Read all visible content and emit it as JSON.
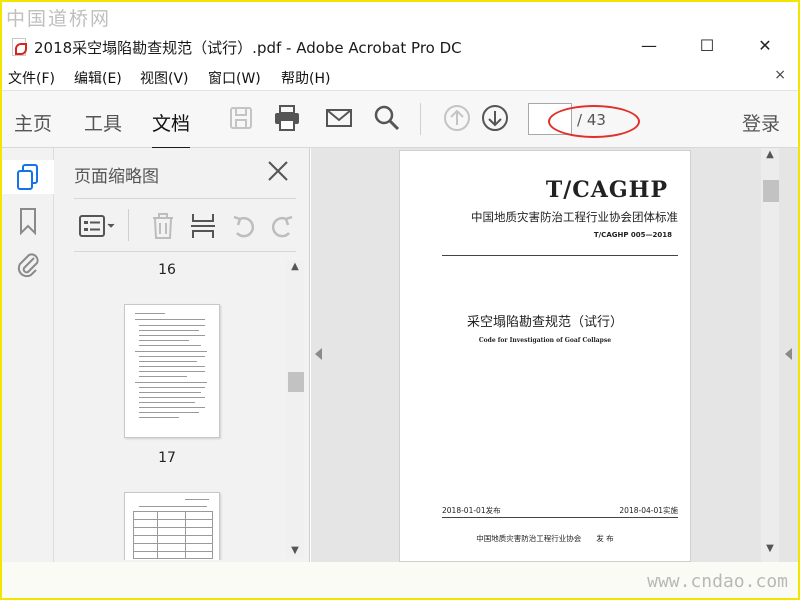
{
  "watermark_top": "中国道桥网",
  "watermark_bottom": "www.cndao.com",
  "window": {
    "title": "2018采空塌陷勘查规范（试行）.pdf - Adobe Acrobat Pro DC",
    "minimize": "—",
    "maximize": "☐",
    "close": "✕"
  },
  "menu": {
    "items": [
      "文件(F)",
      "编辑(E)",
      "视图(V)",
      "窗口(W)",
      "帮助(H)"
    ],
    "close": "×"
  },
  "toolbar": {
    "tabs": [
      "主页",
      "工具",
      "文档"
    ],
    "active_tab": "文档",
    "page_current": "",
    "page_total": "/ 43",
    "login": "登录"
  },
  "thumbnail_panel": {
    "title": "页面缩略图",
    "page_labels": [
      "16",
      "17"
    ]
  },
  "document": {
    "std_code": "T/CAGHP",
    "org_standard": "中国地质灾害防治工程行业协会团体标准",
    "std_number": "T/CAGHP 005—2018",
    "title_cn": "采空塌陷勘查规范（试行）",
    "title_en": "Code for Investigation of Goaf Collapse",
    "issue_date": "2018-01-01发布",
    "effective_date": "2018-04-01实施",
    "publisher": "中国地质灾害防治工程行业协会　　发 布"
  },
  "colors": {
    "border": "#f2e600",
    "annotation": "#e0302a",
    "toolbar_bg": "#f7f7f7"
  }
}
